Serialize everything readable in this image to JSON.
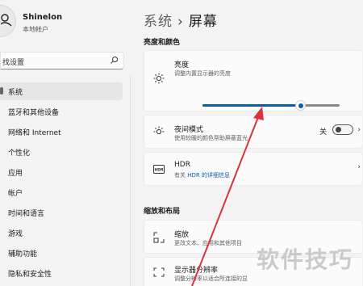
{
  "user": {
    "name": "Shinelon",
    "account": "本地帐户"
  },
  "search": {
    "text": "找设置"
  },
  "nav": {
    "items": [
      {
        "label": "系统",
        "active": true
      },
      {
        "label": "蓝牙和其他设备"
      },
      {
        "label": "网络和 Internet"
      },
      {
        "label": "个性化"
      },
      {
        "label": "应用"
      },
      {
        "label": "帐户"
      },
      {
        "label": "时间和语言"
      },
      {
        "label": "游戏"
      },
      {
        "label": "辅助功能"
      },
      {
        "label": "隐私和安全性"
      }
    ]
  },
  "breadcrumb": {
    "parent": "系统",
    "separator": "›",
    "current": "屏幕"
  },
  "sections": {
    "brightness_color": "亮度和颜色",
    "scale_layout": "缩放和布局"
  },
  "brightness": {
    "title": "亮度",
    "subtitle": "调整内置显示器的亮度",
    "value_percent": 71
  },
  "night_light": {
    "title": "夜间模式",
    "subtitle": "使用较暖的颜色帮助屏蔽蓝光",
    "state_label": "关"
  },
  "hdr": {
    "title": "HDR",
    "link_prefix": "有关 ",
    "link_text": "HDR 的详细信息"
  },
  "scale": {
    "title": "缩放",
    "subtitle": "更改文本、应用和其他项目"
  },
  "resolution": {
    "title": "显示器分辨率",
    "subtitle": "调整分辨率以适合所连接的显"
  },
  "watermark": "软件技巧",
  "colors": {
    "accent": "#0a5cad",
    "annotation_arrow": "#d9333f"
  }
}
